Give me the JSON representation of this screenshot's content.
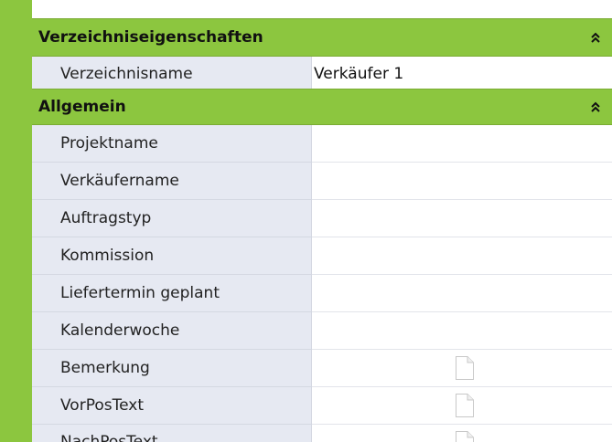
{
  "sections": [
    {
      "title": "Verzeichniseigenschaften",
      "rows": [
        {
          "label": "Verzeichnisname",
          "value": "Verkäufer 1"
        }
      ]
    },
    {
      "title": "Allgemein",
      "rows": [
        {
          "label": "Projektname",
          "value": ""
        },
        {
          "label": "Verkäufername",
          "value": ""
        },
        {
          "label": "Auftragstyp",
          "value": ""
        },
        {
          "label": "Kommission",
          "value": ""
        },
        {
          "label": "Liefertermin geplant",
          "value": ""
        },
        {
          "label": "Kalenderwoche",
          "value": ""
        },
        {
          "label": "Bemerkung",
          "value": "",
          "icon": "document-icon"
        },
        {
          "label": "VorPosText",
          "value": "",
          "icon": "document-icon"
        },
        {
          "label": "NachPosText",
          "value": "",
          "icon": "document-icon"
        }
      ]
    }
  ],
  "colors": {
    "header_green": "#8cc63f",
    "label_bg": "#e6e9f2",
    "value_bg": "#ffffff"
  }
}
